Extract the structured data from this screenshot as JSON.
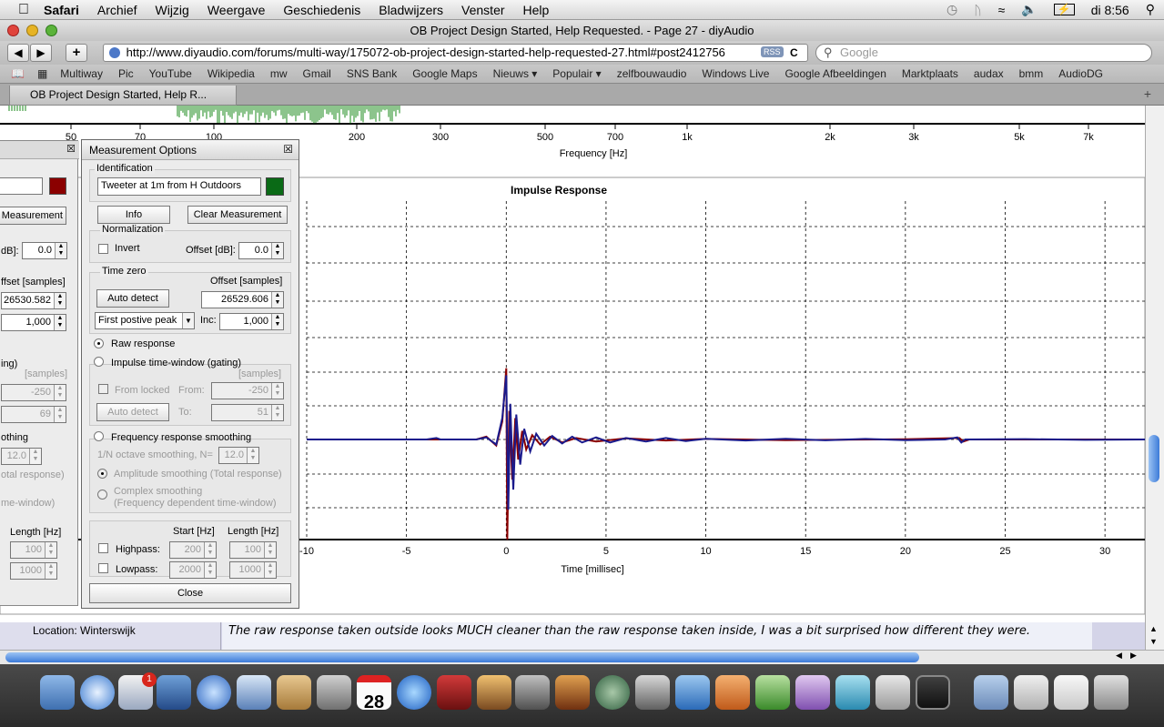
{
  "menubar": {
    "app": "Safari",
    "items": [
      "Archief",
      "Wijzig",
      "Weergave",
      "Geschiedenis",
      "Bladwijzers",
      "Venster",
      "Help"
    ],
    "clock": "di 8:56"
  },
  "window": {
    "title": "OB Project Design Started, Help Requested. - Page 27 - diyAudio"
  },
  "toolbar": {
    "back": "◀",
    "forward": "▶",
    "add": "+",
    "url": "http://www.diyaudio.com/forums/multi-way/175072-ob-project-design-started-help-requested-27.html#post2412756",
    "rss": "RSS",
    "reload": "C",
    "search_placeholder": "Google"
  },
  "bookmarks": [
    "Multiway",
    "Pic",
    "YouTube",
    "Wikipedia",
    "mw",
    "Gmail",
    "SNS Bank",
    "Google Maps",
    "Nieuws ▾",
    "Populair ▾",
    "zelfbouwaudio",
    "Windows Live",
    "Google Afbeeldingen",
    "Marktplaats",
    "audax",
    "bmm",
    "AudioDG"
  ],
  "tabs": [
    {
      "label": "OB Project Design Started, Help R..."
    }
  ],
  "freq_plot": {
    "xlabel": "Frequency [Hz]",
    "ticks": [
      "50",
      "70",
      "100",
      "200",
      "300",
      "500",
      "700",
      "1k",
      "2k",
      "3k",
      "5k",
      "7k"
    ]
  },
  "impulse_plot": {
    "title": "Impulse Response",
    "xlabel": "Time [millisec]",
    "ticks": [
      "-10",
      "-5",
      "0",
      "5",
      "10",
      "15",
      "20",
      "25",
      "30"
    ]
  },
  "chart_data": {
    "type": "line",
    "title": "Impulse Response",
    "xlabel": "Time [millisec]",
    "x_ticks": [
      -10,
      -5,
      0,
      5,
      10,
      15,
      20,
      25,
      30
    ],
    "xlim": [
      -10,
      32
    ],
    "series": [
      {
        "color": "#1a1a8c",
        "points": [
          [
            -10,
            0
          ],
          [
            -4,
            0
          ],
          [
            -3.5,
            0.02
          ],
          [
            -3.3,
            0
          ],
          [
            -1.5,
            0
          ],
          [
            -1,
            0.03
          ],
          [
            -0.5,
            -0.05
          ],
          [
            -0.2,
            0.3
          ],
          [
            0,
            0.9
          ],
          [
            0.1,
            -0.7
          ],
          [
            0.2,
            0.5
          ],
          [
            0.35,
            -0.5
          ],
          [
            0.5,
            0.35
          ],
          [
            0.7,
            -0.25
          ],
          [
            0.9,
            0.15
          ],
          [
            1.2,
            -0.12
          ],
          [
            1.5,
            0.08
          ],
          [
            1.9,
            -0.06
          ],
          [
            2.3,
            0.05
          ],
          [
            2.8,
            -0.04
          ],
          [
            3.3,
            0.04
          ],
          [
            3.8,
            -0.03
          ],
          [
            4.5,
            0.03
          ],
          [
            5.2,
            -0.03
          ],
          [
            6,
            0.02
          ],
          [
            7,
            -0.02
          ],
          [
            8,
            0.02
          ],
          [
            9,
            -0.015
          ],
          [
            10,
            0.01
          ],
          [
            12,
            -0.01
          ],
          [
            14,
            0.01
          ],
          [
            16,
            -0.008
          ],
          [
            18,
            0.008
          ],
          [
            20,
            -0.006
          ],
          [
            22,
            0
          ],
          [
            22.6,
            0.03
          ],
          [
            22.8,
            -0.03
          ],
          [
            23,
            0
          ],
          [
            26,
            0.005
          ],
          [
            29,
            -0.004
          ],
          [
            32,
            0
          ]
        ]
      },
      {
        "color": "#8b0000",
        "points": [
          [
            -10,
            0
          ],
          [
            -1.5,
            0
          ],
          [
            -1,
            0.04
          ],
          [
            -0.5,
            -0.06
          ],
          [
            -0.2,
            0.25
          ],
          [
            0,
            1.0
          ],
          [
            0.05,
            -1.0
          ],
          [
            0.15,
            0.4
          ],
          [
            0.3,
            -0.4
          ],
          [
            0.45,
            0.3
          ],
          [
            0.6,
            -0.2
          ],
          [
            0.8,
            0.12
          ],
          [
            1,
            -0.1
          ],
          [
            1.3,
            0.06
          ],
          [
            1.7,
            -0.05
          ],
          [
            2.2,
            0.04
          ],
          [
            2.8,
            -0.03
          ],
          [
            3.5,
            0.02
          ],
          [
            4.5,
            -0.02
          ],
          [
            6,
            0.015
          ],
          [
            8,
            -0.01
          ],
          [
            10,
            0.008
          ],
          [
            14,
            -0.006
          ],
          [
            20,
            0.004
          ],
          [
            22.7,
            0.02
          ],
          [
            22.9,
            -0.02
          ],
          [
            23.2,
            0
          ],
          [
            32,
            0
          ]
        ]
      }
    ]
  },
  "left_panel": {
    "offset_label": "dB]:",
    "offset_value": "0.0",
    "samples_header": "ffset [samples]",
    "samples_value": "26530.582",
    "inc_value": "1,000",
    "gating": "ing)",
    "samples_unit": "[samples]",
    "from_value": "-250",
    "to_value": "69",
    "smoothing": "othing",
    "oct_value": "12.0",
    "total": "otal response)",
    "timewin": "me-window)",
    "length_header": "Length [Hz]",
    "hp_len": "100",
    "lp_len": "1000",
    "clear_btn": "r Measurement"
  },
  "dialog": {
    "title": "Measurement Options",
    "close_x": "☒",
    "identification": {
      "label": "Identification",
      "name": "Tweeter at 1m from H Outdoors",
      "color": "#0a6a16"
    },
    "info_btn": "Info",
    "clear_btn": "Clear Measurement",
    "normalization": {
      "label": "Normalization",
      "invert": "Invert",
      "offset_label": "Offset [dB]:",
      "offset_value": "0.0"
    },
    "time_zero": {
      "label": "Time zero",
      "offset_header": "Offset [samples]",
      "auto_btn": "Auto detect",
      "offset_value": "26529.606",
      "mode": "First postive peak",
      "inc_label": "Inc:",
      "inc_value": "1,000"
    },
    "raw_response": "Raw response",
    "gating": {
      "label": "Impulse time-window (gating)",
      "unit": "[samples]",
      "from_locked": "From locked",
      "from_label": "From:",
      "from_value": "-250",
      "auto_btn": "Auto detect",
      "to_label": "To:",
      "to_value": "51"
    },
    "smoothing": {
      "label": "Frequency response smoothing",
      "oct_label": "1/N octave smoothing, N=",
      "oct_value": "12.0",
      "amplitude": "Amplitude smoothing (Total response)",
      "complex": "Complex smoothing",
      "complex_sub": "(Frequency dependent time-window)"
    },
    "filters": {
      "start_header": "Start [Hz]",
      "length_header": "Length [Hz]",
      "hp_label": "Highpass:",
      "hp_start": "200",
      "hp_length": "100",
      "lp_label": "Lowpass:",
      "lp_start": "2000",
      "lp_length": "1000"
    },
    "close_btn": "Close"
  },
  "forum": {
    "location": "Location: Winterswijk",
    "post": "The raw response taken outside looks MUCH cleaner than the raw response taken inside, I was a bit surprised how different they were."
  },
  "dock": {
    "calendar_day": "28",
    "mail_badge": "1"
  }
}
